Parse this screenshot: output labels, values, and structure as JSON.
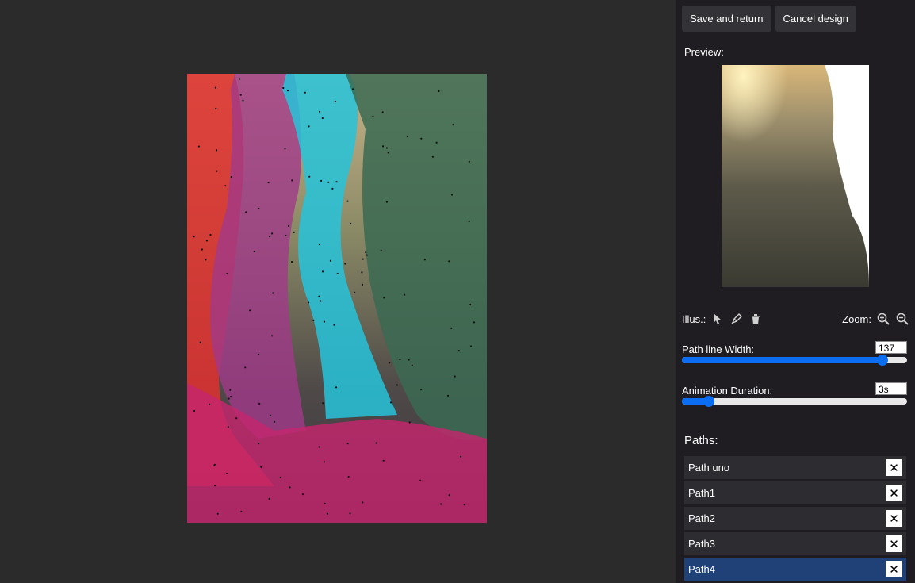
{
  "toolbar": {
    "save_label": "Save and return",
    "cancel_label": "Cancel design"
  },
  "preview": {
    "label": "Preview:"
  },
  "tools": {
    "illus_label": "Illus.:",
    "zoom_label": "Zoom:",
    "icons": [
      "cursor-icon",
      "pen-icon",
      "trash-icon",
      "zoom-in-icon",
      "zoom-out-icon"
    ]
  },
  "sliders": {
    "path_width": {
      "label": "Path line Width:",
      "value": "137",
      "fraction": 0.89
    },
    "animation": {
      "label": "Animation Duration:",
      "value": "3s",
      "fraction": 0.12
    }
  },
  "paths": {
    "title": "Paths:",
    "items": [
      {
        "label": "Path uno",
        "selected": false
      },
      {
        "label": "Path1",
        "selected": false
      },
      {
        "label": "Path2",
        "selected": false
      },
      {
        "label": "Path3",
        "selected": false
      },
      {
        "label": "Path4",
        "selected": true
      }
    ],
    "remove_glyph": "✕"
  },
  "colors": {
    "accent": "#0b6ef2",
    "selected_row": "#1f4178",
    "path_red": "#e0302f",
    "path_purple": "#a13a8a",
    "path_cyan": "#26c3da",
    "path_green": "#3b6a52",
    "path_pink": "#c4266e"
  }
}
